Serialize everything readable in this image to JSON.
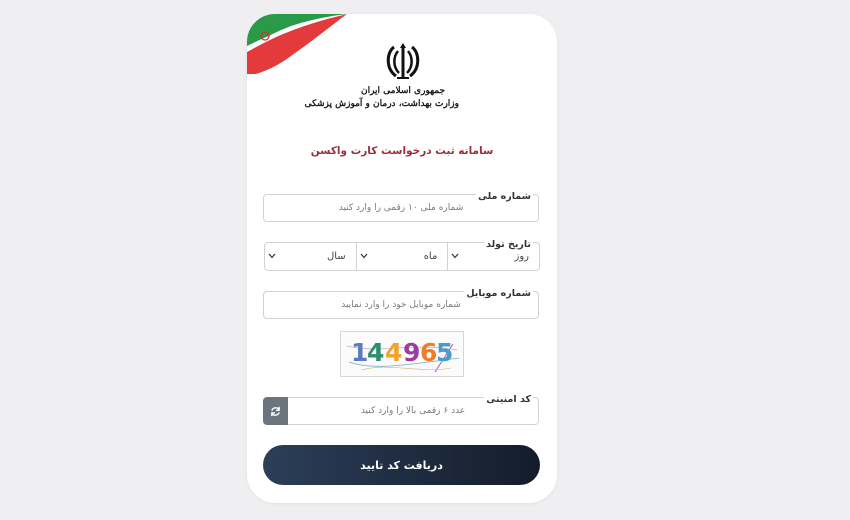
{
  "header": {
    "ministry_line1": "جمهوری اسلامی ایران",
    "ministry_line2": "وزارت بهداشت، درمان و آموزش پزشکی",
    "title": "سامانه ثبت درخواست کارت واکسن"
  },
  "form": {
    "national_id": {
      "label": "شماره ملی",
      "placeholder": "شماره ملی ۱۰ رقمی را وارد کنید"
    },
    "birth_date": {
      "label": "تاریخ تولد",
      "day": "روز",
      "month": "ماه",
      "year": "سال"
    },
    "mobile": {
      "label": "شماره موبایل",
      "placeholder": "شماره موبایل خود را وارد نمایید"
    },
    "captcha": {
      "digits": [
        "1",
        "4",
        "4",
        "9",
        "6",
        "5"
      ],
      "colors": [
        "#5b7ac0",
        "#2c8d6f",
        "#f0a32a",
        "#9b3ca0",
        "#f07c28",
        "#4a9cc8"
      ]
    },
    "security_code": {
      "label": "کد امنیتی",
      "placeholder": "عدد ۶ رقمی بالا را وارد کنید"
    },
    "submit_label": "دریافت کد تایید"
  },
  "colors": {
    "title": "#9b2c3c",
    "button": "#1f2d42",
    "refresh": "#6c757d"
  }
}
